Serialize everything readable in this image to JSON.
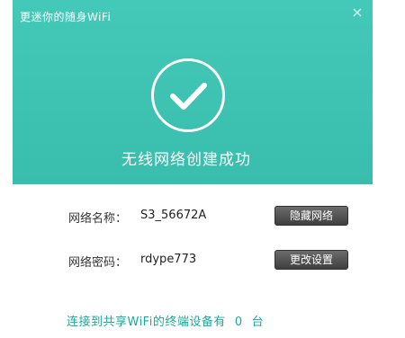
{
  "window": {
    "title": "更迷你的随身WiFi",
    "close_icon": "close-icon",
    "close_glyph": "×",
    "header_color": "#3fc3b3",
    "check_icon": "checkmark-icon"
  },
  "status": {
    "message": "无线网络创建成功"
  },
  "network": {
    "name_label": "网络名称：",
    "name_value": "S3_56672A",
    "hide_button": "隐藏网络",
    "password_label": "网络密码：",
    "password_value": "rdype773",
    "settings_button": "更改设置"
  },
  "footer": {
    "text_before": "连接到共享WiFi的终端设备有",
    "count": "0",
    "text_after": "台",
    "color": "#1aa99a"
  }
}
